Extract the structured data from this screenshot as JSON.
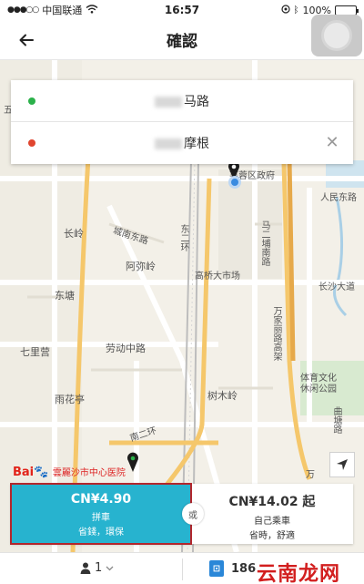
{
  "status_bar": {
    "carrier": "中国联通",
    "time": "16:57",
    "battery": "100%"
  },
  "nav": {
    "title": "確認"
  },
  "route": {
    "start_text": "马路",
    "end_text": "摩根"
  },
  "map": {
    "labels": {
      "furong": "芙蓉区政府",
      "renmin": "人民东路",
      "changling": "长岭",
      "chengnan": "城南东路",
      "ma_er": "马二埔南路",
      "dongta": "东塘",
      "axiling": "阿弥岭",
      "gaoqiao": "高桥大市场",
      "changsha_da": "长沙大道",
      "qiliying": "七里营",
      "laodong": "劳动中路",
      "wanjia": "万家丽路高架",
      "tiyu": "体育文化休闲公园",
      "yuhua": "雨花亭",
      "shumu": "树木岭",
      "qutang": "曲塘路",
      "dong_er": "东二环",
      "nan_er": "南二环",
      "wan_r": "万",
      "wu": "五"
    }
  },
  "map_attribution": {
    "baidu": "Bai",
    "hospital": "雲麗沙市中心医院"
  },
  "fares": {
    "pool": {
      "price": "CN¥4.90",
      "name": "拼車",
      "note": "省錢，環保"
    },
    "or_label": "或",
    "solo": {
      "price": "CN¥14.02 起",
      "name": "自己乘車",
      "note": "省時，舒適"
    }
  },
  "bottom": {
    "seats": "1",
    "phone": "186"
  },
  "watermark": "云南龙网",
  "colors": {
    "pool_accent": "#27b3cf",
    "selected_border": "#b3262c",
    "start_dot": "#2bb14a",
    "end_dot": "#e0452f"
  }
}
